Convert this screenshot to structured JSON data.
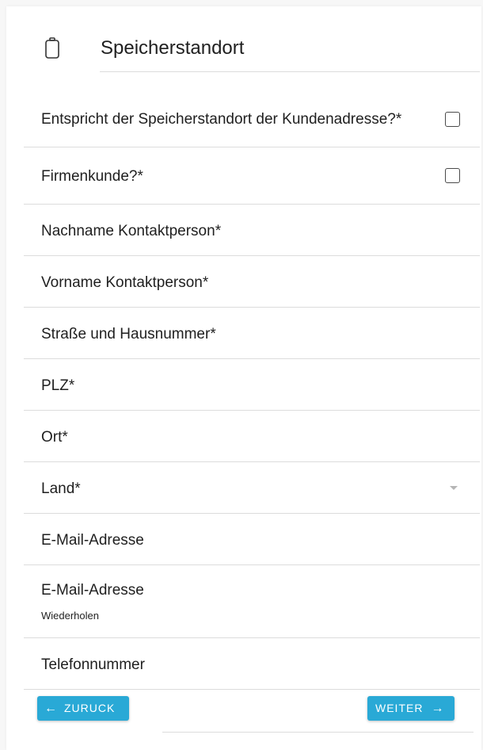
{
  "header": {
    "title": "Speicherstandort",
    "icon": "battery-icon"
  },
  "fields": {
    "same_address": {
      "label": "Entspricht der Speicherstandort der Kundenadresse?*",
      "checked": false
    },
    "business_customer": {
      "label": "Firmenkunde?*",
      "checked": false
    },
    "last_name": {
      "label": "Nachname Kontaktperson*",
      "value": ""
    },
    "first_name": {
      "label": "Vorname Kontaktperson*",
      "value": ""
    },
    "street": {
      "label": "Straße und Hausnummer*",
      "value": ""
    },
    "zip": {
      "label": "PLZ*",
      "value": ""
    },
    "city": {
      "label": "Ort*",
      "value": ""
    },
    "country": {
      "label": "Land*",
      "value": ""
    },
    "email": {
      "label": "E-Mail-Adresse",
      "value": ""
    },
    "email_repeat": {
      "label": "E-Mail-Adresse",
      "sublabel": "Wiederholen",
      "value": ""
    },
    "phone": {
      "label": "Telefonnummer",
      "value": ""
    }
  },
  "buttons": {
    "back": {
      "label": "ZURUCK",
      "icon": "arrow-left-icon",
      "arrow": "←"
    },
    "next": {
      "label": "WEITER",
      "icon": "arrow-right-icon",
      "arrow": "→"
    }
  },
  "colors": {
    "accent": "#29a9d6",
    "divider": "#dcdcdc",
    "text": "#1f1f1f"
  }
}
